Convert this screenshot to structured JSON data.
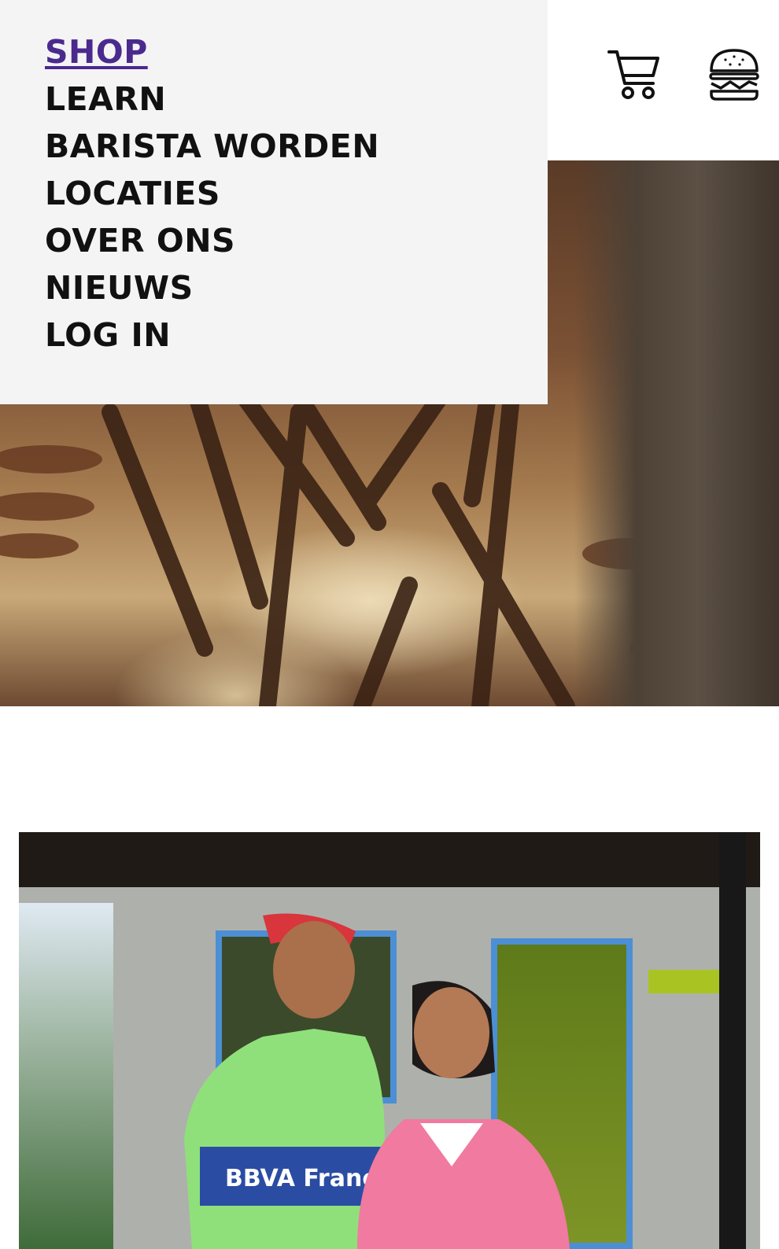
{
  "menu": {
    "items": [
      {
        "label": "SHOP",
        "active": true
      },
      {
        "label": "LEARN",
        "active": false
      },
      {
        "label": "BARISTA WORDEN",
        "active": false
      },
      {
        "label": "LOCATIES",
        "active": false
      },
      {
        "label": "OVER ONS",
        "active": false
      },
      {
        "label": "NIEUWS",
        "active": false
      },
      {
        "label": "LOG IN",
        "active": false
      }
    ]
  },
  "header": {
    "icons": [
      "cart-icon",
      "hamburger-burger-icon"
    ]
  },
  "photo2": {
    "jersey_text": "BBVA Francés"
  },
  "colors": {
    "accent": "#4b2a8e",
    "menu_bg": "#f4f4f4",
    "text": "#111111"
  }
}
